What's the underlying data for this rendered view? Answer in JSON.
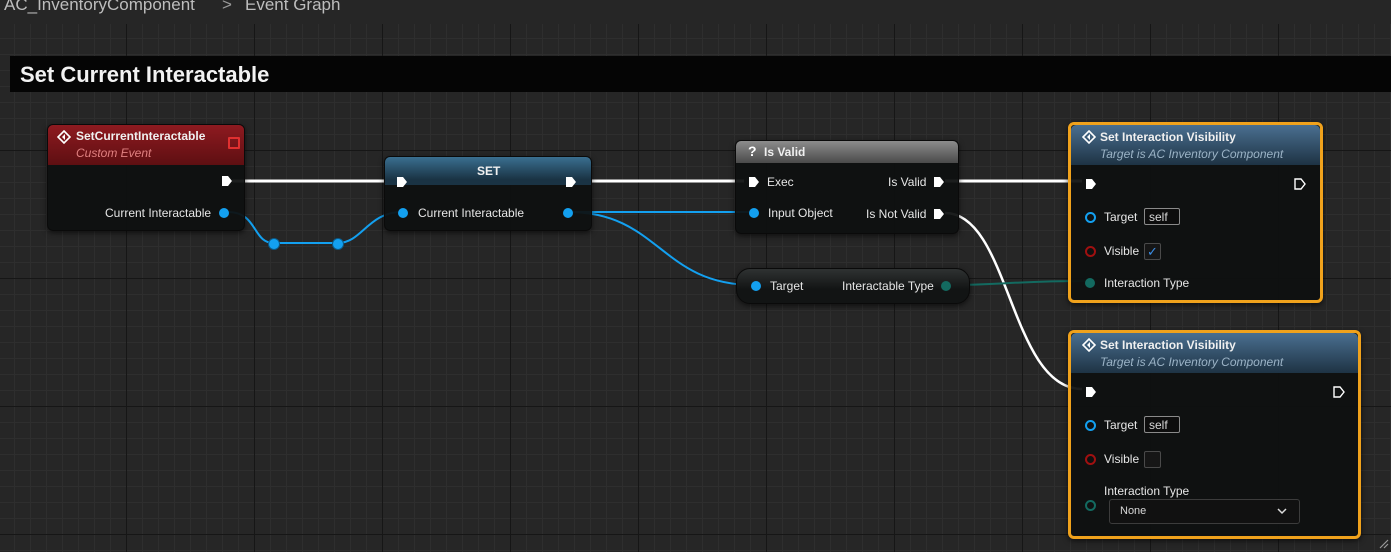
{
  "breadcrumb": {
    "root": "AC_InventoryComponent",
    "separator": ">",
    "graph": "Event Graph"
  },
  "comment": {
    "title": "Set Current Interactable"
  },
  "nodes": {
    "custom_event": {
      "title": "SetCurrentInteractable",
      "subtitle": "Custom Event",
      "output_pin": "Current Interactable",
      "header_color": "#7a1418"
    },
    "set": {
      "title": "SET",
      "pin": "Current Interactable",
      "header_color": "#2a5a78"
    },
    "is_valid": {
      "title": "Is Valid",
      "icon": "question-mark-icon",
      "exec_in": "Exec",
      "input": "Input Object",
      "out_valid": "Is Valid",
      "out_not_valid": "Is Not Valid"
    },
    "get_type": {
      "input": "Target",
      "output": "Interactable Type"
    },
    "visibility_1": {
      "title": "Set Interaction Visibility",
      "subtitle": "Target is AC Inventory Component",
      "target_label": "Target",
      "target_value": "self",
      "visible_label": "Visible",
      "visible_checked": true,
      "type_label": "Interaction Type"
    },
    "visibility_2": {
      "title": "Set Interaction Visibility",
      "subtitle": "Target is AC Inventory Component",
      "target_label": "Target",
      "target_value": "self",
      "visible_label": "Visible",
      "visible_checked": false,
      "type_label": "Interaction Type",
      "type_value": "None"
    }
  },
  "colors": {
    "selection": "#f0a21c",
    "object_pin": "#13a0f0",
    "enum_pin": "#136a60",
    "bool_pin": "#a01010"
  }
}
